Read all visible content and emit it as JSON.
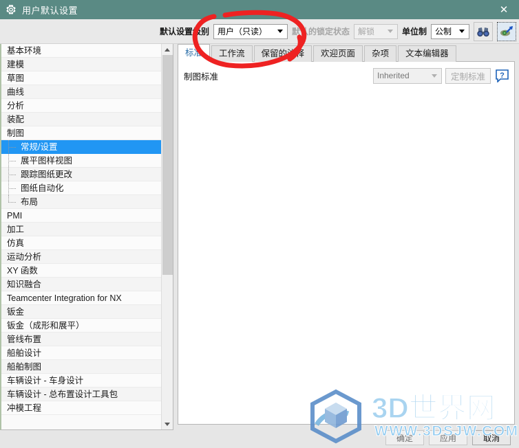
{
  "window": {
    "title": "用户默认设置",
    "gear_icon": "gear-icon",
    "close_label": "✕"
  },
  "toolbar": {
    "level_label": "默认设置级别",
    "level_value": "用户（只读）",
    "lock_label": "默认的锁定状态",
    "lock_value": "解锁",
    "unit_label": "单位制",
    "unit_value": "公制",
    "find_icon": "binoculars-icon",
    "find_next_icon": "binoculars-arrow-icon"
  },
  "tree": {
    "items": [
      {
        "label": "基本环境",
        "level": 0,
        "selected": false
      },
      {
        "label": "建模",
        "level": 0,
        "selected": false
      },
      {
        "label": "草图",
        "level": 0,
        "selected": false
      },
      {
        "label": "曲线",
        "level": 0,
        "selected": false
      },
      {
        "label": "分析",
        "level": 0,
        "selected": false
      },
      {
        "label": "装配",
        "level": 0,
        "selected": false
      },
      {
        "label": "制图",
        "level": 0,
        "selected": false
      },
      {
        "label": "常规/设置",
        "level": 1,
        "selected": true
      },
      {
        "label": "展平图样视图",
        "level": 1,
        "selected": false
      },
      {
        "label": "跟踪图纸更改",
        "level": 1,
        "selected": false
      },
      {
        "label": "图纸自动化",
        "level": 1,
        "selected": false
      },
      {
        "label": "布局",
        "level": 1,
        "selected": false,
        "last": true
      },
      {
        "label": "PMI",
        "level": 0,
        "selected": false
      },
      {
        "label": "加工",
        "level": 0,
        "selected": false
      },
      {
        "label": "仿真",
        "level": 0,
        "selected": false
      },
      {
        "label": "运动分析",
        "level": 0,
        "selected": false
      },
      {
        "label": "XY 函数",
        "level": 0,
        "selected": false
      },
      {
        "label": "知识融合",
        "level": 0,
        "selected": false
      },
      {
        "label": "Teamcenter Integration for NX",
        "level": 0,
        "selected": false
      },
      {
        "label": "钣金",
        "level": 0,
        "selected": false
      },
      {
        "label": "钣金（成形和展平）",
        "level": 0,
        "selected": false
      },
      {
        "label": "管线布置",
        "level": 0,
        "selected": false
      },
      {
        "label": "船舶设计",
        "level": 0,
        "selected": false
      },
      {
        "label": "船舶制图",
        "level": 0,
        "selected": false
      },
      {
        "label": "车辆设计 - 车身设计",
        "level": 0,
        "selected": false
      },
      {
        "label": "车辆设计 - 总布置设计工具包",
        "level": 0,
        "selected": false
      },
      {
        "label": "冲模工程",
        "level": 0,
        "selected": false
      }
    ],
    "scroll_up_icon": "chevron-up-icon",
    "scroll_down_icon": "chevron-down-icon"
  },
  "tabs": [
    {
      "label": "标准",
      "active": true
    },
    {
      "label": "工作流",
      "active": false
    },
    {
      "label": "保留的注释",
      "active": false
    },
    {
      "label": "欢迎页面",
      "active": false
    },
    {
      "label": "杂项",
      "active": false
    },
    {
      "label": "文本编辑器",
      "active": false
    }
  ],
  "pane": {
    "drafting_standard_label": "制图标准",
    "drafting_standard_value": "Inherited",
    "customize_standard_label": "定制标准",
    "help_icon": "help-question-icon"
  },
  "buttons": {
    "ok": "确定",
    "apply": "应用",
    "cancel": "取消"
  },
  "watermark": {
    "brand": "3D世界网",
    "url": "WWW.3DSJW.COM",
    "logo_icon": "hexagon-cube-logo-icon"
  },
  "annotation": {
    "shape": "hand-drawn-ellipse",
    "color": "#ee2222"
  },
  "colors": {
    "titlebar": "#5a8a84",
    "selection": "#2196f3",
    "accent_tab": "#2a6ea8",
    "window_bg": "#e6e6e6"
  }
}
